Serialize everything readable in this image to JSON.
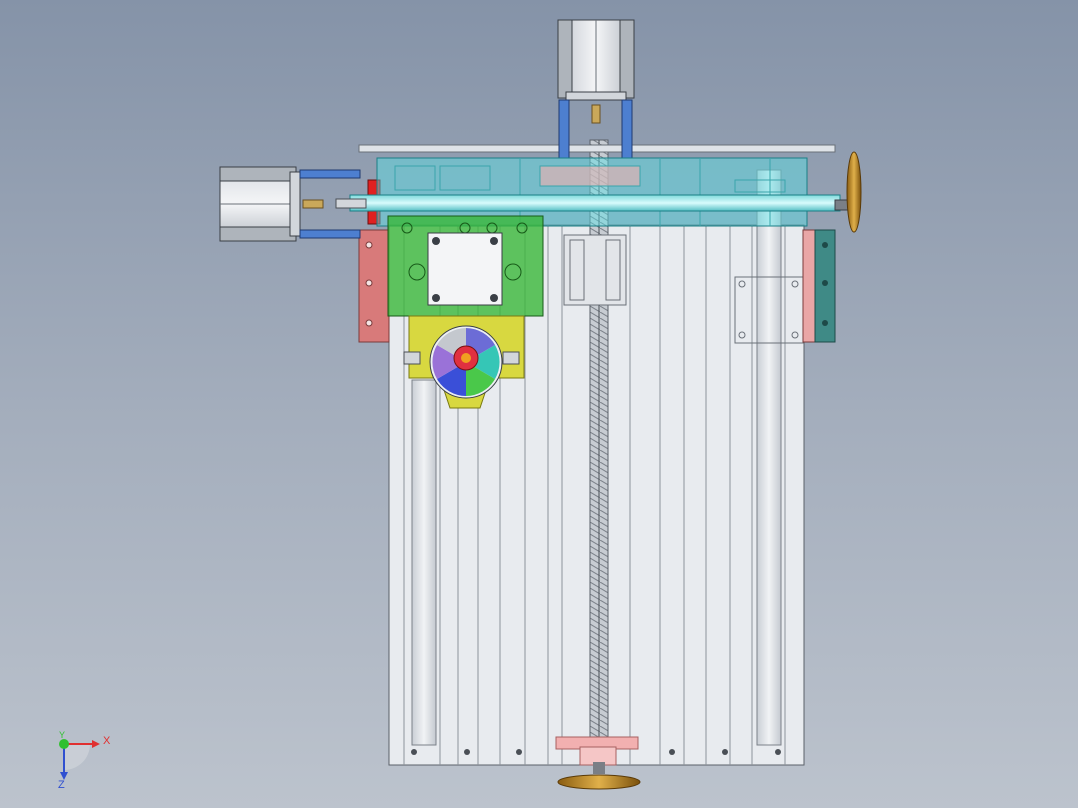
{
  "viewport": {
    "background_top": "#8593a8",
    "background_bottom": "#bcc3cd"
  },
  "model": {
    "frame_color": "#dfe3e8",
    "carriage_color": "#56e0e6",
    "left_motor_mount_color": "#d86c6c",
    "gearbox_color": "#39b83a",
    "fan_housing_color": "#d8d840",
    "handwheel_color": "#c8951e",
    "bracket_color": "#3f8a86"
  },
  "triad": {
    "x_label": "X",
    "y_label": "Y",
    "z_label": "Z"
  }
}
